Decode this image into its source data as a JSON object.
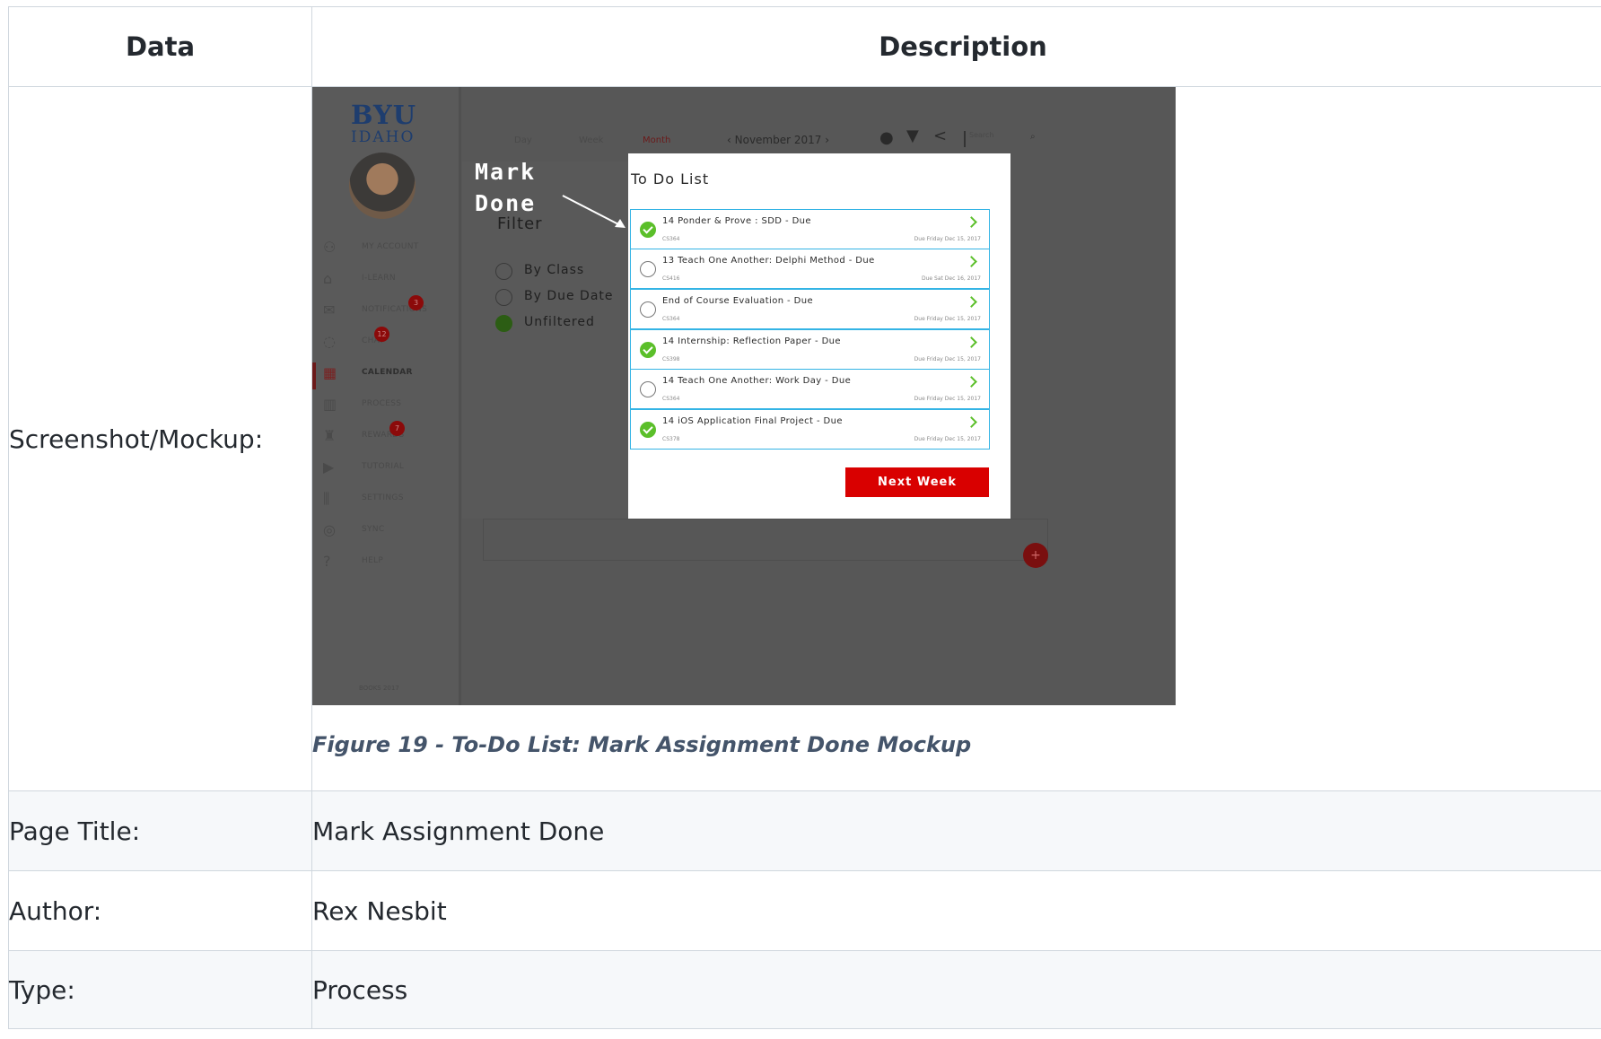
{
  "table": {
    "header_data": "Data",
    "header_description": "Description",
    "rows": {
      "screenshot_label": "Screenshot/Mockup:",
      "page_title_label": "Page Title:",
      "page_title_value": "Mark Assignment Done",
      "author_label": "Author:",
      "author_value": "Rex Nesbit",
      "type_label": "Type:",
      "type_value": "Process"
    },
    "caption": "Figure 19 - To-Do List: Mark Assignment Done Mockup"
  },
  "mockup": {
    "logo": {
      "line1": "BYU",
      "line2": "IDAHO"
    },
    "sidebar": {
      "items": [
        {
          "label": "MY ACCOUNT",
          "icon": "person-icon"
        },
        {
          "label": "I-LEARN",
          "icon": "home-icon"
        },
        {
          "label": "NOTIFICATIONS",
          "icon": "mail-icon",
          "badge": "3"
        },
        {
          "label": "CHAT",
          "icon": "chat-icon",
          "badge": "12"
        },
        {
          "label": "CALENDAR",
          "icon": "calendar-icon",
          "active": true
        },
        {
          "label": "PROCESS",
          "icon": "chart-icon"
        },
        {
          "label": "REWARDS",
          "icon": "trophy-icon",
          "badge": "7"
        },
        {
          "label": "TUTORIAL",
          "icon": "video-icon"
        },
        {
          "label": "SETTINGS",
          "icon": "sliders-icon"
        },
        {
          "label": "SYNC",
          "icon": "sync-icon"
        },
        {
          "label": "HELP",
          "icon": "help-icon"
        }
      ],
      "copyright": "BOOKS 2017"
    },
    "view_tabs": [
      "Day",
      "Week",
      "Month"
    ],
    "month": "November 2017",
    "search_placeholder": "Search",
    "annotation": {
      "line1": "Mark",
      "line2": "Done"
    },
    "filter": {
      "title": "Filter",
      "options": [
        {
          "label": "By Class",
          "selected": false
        },
        {
          "label": "By Due Date",
          "selected": false
        },
        {
          "label": "Unfiltered",
          "selected": true
        }
      ]
    },
    "todo": {
      "title": "To Do List",
      "items": [
        {
          "title": "14 Ponder & Prove : SDD - Due",
          "course": "CS364",
          "due": "Due Friday Dec 15, 2017",
          "done": true
        },
        {
          "title": "13 Teach One Another: Delphi Method - Due",
          "course": "CS416",
          "due": "Due Sat Dec 16, 2017",
          "done": false
        },
        {
          "title": "End of Course Evaluation - Due",
          "course": "CS364",
          "due": "Due Friday Dec 15, 2017",
          "done": false
        },
        {
          "title": "14 Internship: Reflection Paper - Due",
          "course": "CS398",
          "due": "Due Friday Dec 15, 2017",
          "done": true
        },
        {
          "title": "14 Teach One Another: Work Day - Due",
          "course": "CS364",
          "due": "Due Friday Dec 15, 2017",
          "done": false
        },
        {
          "title": "14 iOS Application Final Project - Due",
          "course": "CS378",
          "due": "Due Friday Dec 15, 2017",
          "done": true
        }
      ],
      "next_button": "Next Week"
    },
    "colors": {
      "accent_red": "#d90000",
      "check_green": "#5bbf2a",
      "item_border": "#34b4e5",
      "logo_blue": "#1e3d6e"
    }
  }
}
